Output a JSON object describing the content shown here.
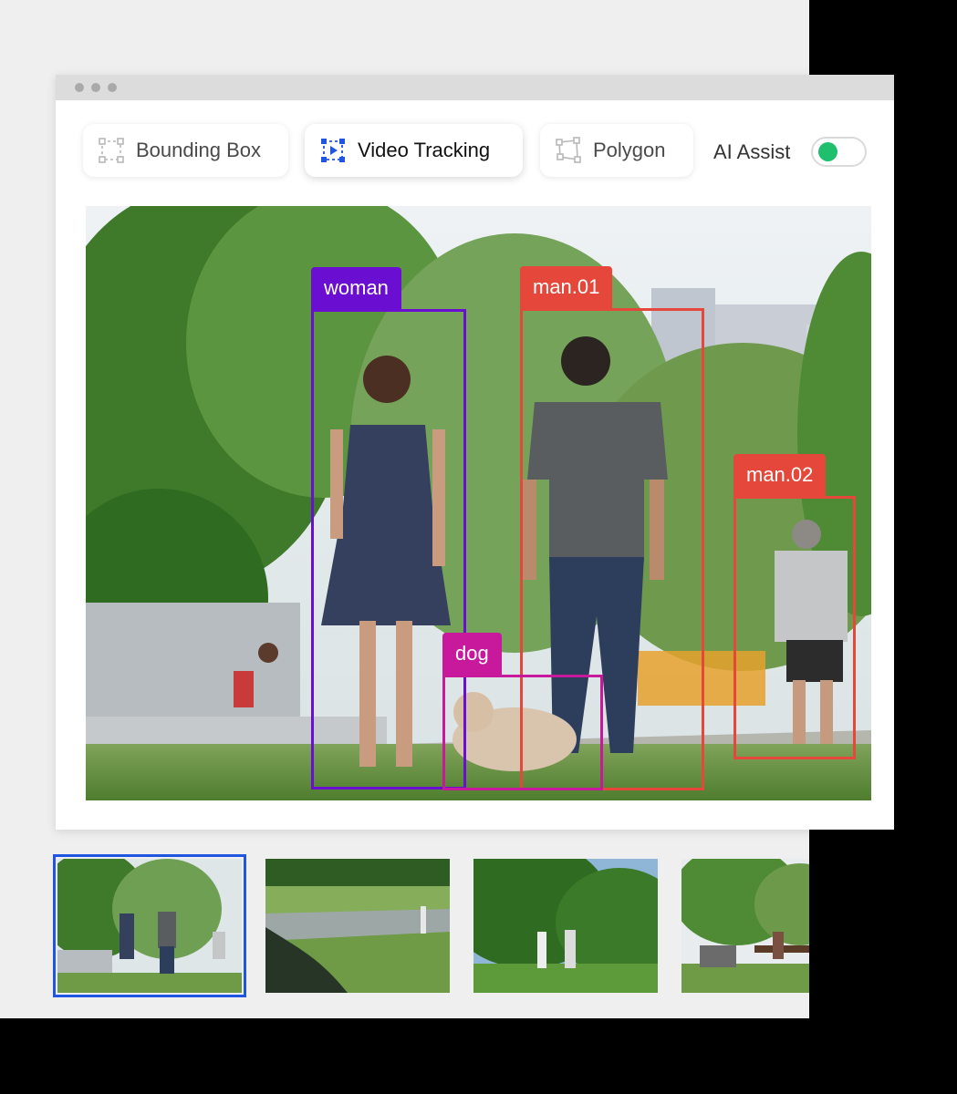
{
  "toolbar": {
    "tools": [
      {
        "label": "Bounding Box",
        "icon": "bounding-box-icon",
        "active": false
      },
      {
        "label": "Video Tracking",
        "icon": "video-tracking-icon",
        "active": true
      },
      {
        "label": "Polygon",
        "icon": "polygon-icon",
        "active": false
      }
    ],
    "ai_assist_label": "AI Assist",
    "ai_assist_on": true
  },
  "annotations": [
    {
      "label": "woman",
      "color": "#6a0fd1"
    },
    {
      "label": "man.01",
      "color": "#e5483a"
    },
    {
      "label": "man.02",
      "color": "#e5483a"
    },
    {
      "label": "dog",
      "color": "#c8189c"
    }
  ],
  "filmstrip": {
    "selected_index": 0,
    "accent_color": "#1f55e0",
    "count": 4
  },
  "colors": {
    "toggle_on": "#1fbf6d",
    "active_tool_icon": "#1f55e0"
  }
}
